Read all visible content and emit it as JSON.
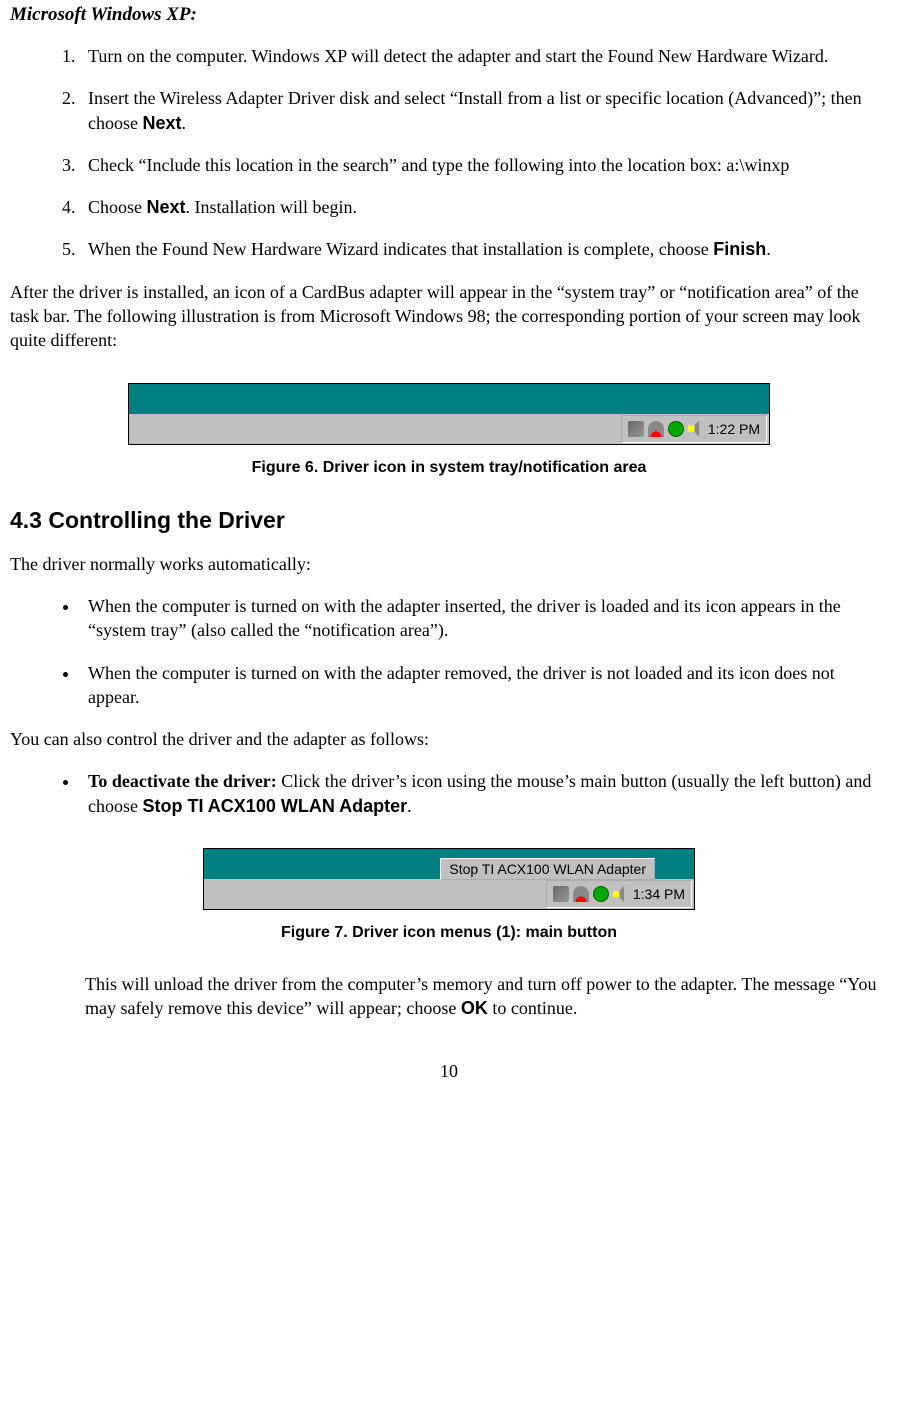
{
  "heading": "Microsoft Windows XP:",
  "steps": {
    "s1": "Turn on the computer. Windows XP will detect the adapter and start the Found New Hardware Wizard.",
    "s2a": "Insert the Wireless Adapter Driver disk and select “Install from a list or specific location (Advanced)”; then choose ",
    "s2b": "Next",
    "s2c": ".",
    "s3": "Check “Include this location in the search” and type the following into the location box: a:\\winxp",
    "s4a": "Choose ",
    "s4b": "Next",
    "s4c": ". Installation will begin.",
    "s5a": "When the Found New Hardware Wizard indicates that installation is complete, choose ",
    "s5b": "Finish",
    "s5c": "."
  },
  "after_para": "After the driver is installed, an icon of a CardBus adapter will appear in the “system tray” or “notification area” of the task bar. The following illustration is from Microsoft Windows 98; the corresponding portion of your screen may look quite different:",
  "fig6": {
    "time": "1:22 PM",
    "caption": "Figure 6.  Driver icon in system tray/notification area"
  },
  "section": "4.3   Controlling the Driver",
  "p_auto": "The driver normally works automatically:",
  "bullets1": {
    "b1": "When the computer is turned on with the adapter inserted, the driver is loaded and its icon appears in the “system tray” (also called the “notification area”).",
    "b2": "When the computer is turned on with the adapter removed, the driver is not loaded and its icon does not appear."
  },
  "p_control": "You can also control the driver and the adapter as follows:",
  "deact": {
    "lead": "To deactivate the driver:",
    "resta": "  Click the driver’s icon using the mouse’s main button (usually the left button) and choose ",
    "restb": "Stop TI ACX100 WLAN Adapter",
    "restc": "."
  },
  "fig7": {
    "menu": "Stop TI ACX100 WLAN Adapter",
    "time": "1:34 PM",
    "caption": "Figure 7.  Driver icon menus (1): main button"
  },
  "unload": {
    "a": "This will unload the driver from the computer’s memory and turn off power to the adapter. The message “You may safely remove this device” will appear; choose ",
    "b": "OK",
    "c": " to continue."
  },
  "page": "10"
}
